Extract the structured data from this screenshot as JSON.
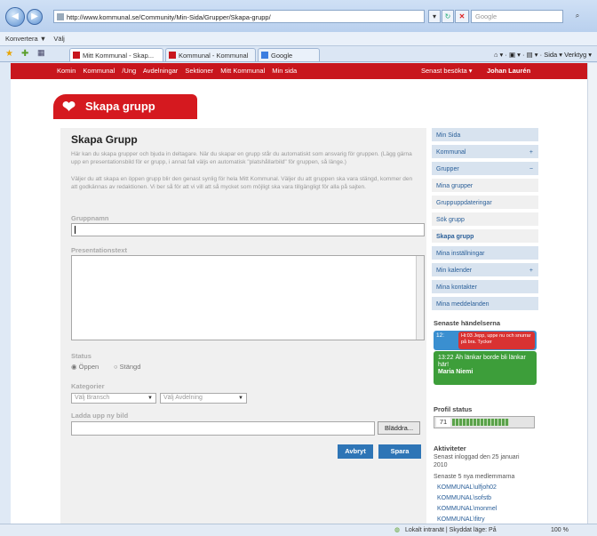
{
  "browser": {
    "url": "http://www.kommunal.se/Community/Min-Sida/Grupper/Skapa-grupp/",
    "search_placeholder": "Google",
    "links_bar": [
      "Konvertera",
      "▼",
      "Välj"
    ],
    "tabs": [
      "Mitt Kommunal - Skap...",
      "Kommunal - Kommunal",
      "Google"
    ],
    "tools": "Sida ▾  Verktyg ▾",
    "status_zone": "Lokalt intranät | Skyddat läge: På",
    "zoom": "100 %"
  },
  "site_nav": {
    "links": [
      "Komin",
      "Kommunal",
      "/Ung",
      "Avdelningar",
      "Sektioner",
      "Mitt Kommunal",
      "Min sida"
    ],
    "latest": "Senast besökta ▾",
    "user": "Johan Laurén"
  },
  "header": {
    "badge": "Skapa grupp"
  },
  "form": {
    "title": "Skapa Grupp",
    "intro1": "Här kan du skapa grupper och bjuda in deltagare. När du skapar en grupp står du automatiskt som ansvarig för gruppen. (Lägg gärna upp en presentationsbild för er grupp, i annat fall väljs en automatisk \"platshållarbild\" för gruppen, så länge.)",
    "intro2": "Väljer du att skapa en öppen grupp blir den genast synlig för hela Mitt Kommunal. Väljer du att gruppen ska vara stängd, kommer den att godkännas av redaktionen. Vi ber så för att vi vill att så mycket som möjligt ska vara tillgängligt för alla på sajten.",
    "name_label": "Gruppnamn",
    "name_value": "",
    "presentation_label": "Presentationstext",
    "status_label": "Status",
    "status_open": "Öppen",
    "status_closed": "Stängd",
    "category_label": "Kategorier",
    "branch_select": "Välj Bransch",
    "department_select": "Välj Avdelning",
    "upload_label": "Ladda upp ny bild",
    "browse": "Bläddra...",
    "cancel": "Avbryt",
    "save": "Spara"
  },
  "sidebar": {
    "items": [
      {
        "label": "Min Sida",
        "mark": ""
      },
      {
        "label": "Kommunal",
        "mark": "+"
      },
      {
        "label": "Grupper",
        "mark": "−"
      },
      {
        "label": "Mina grupper",
        "mark": ""
      },
      {
        "label": "Gruppuppdateringar",
        "mark": ""
      },
      {
        "label": "Sök grupp",
        "mark": ""
      },
      {
        "label": "Skapa grupp",
        "mark": ""
      },
      {
        "label": "Mina inställningar",
        "mark": ""
      },
      {
        "label": "Min kalender",
        "mark": "+"
      },
      {
        "label": "Mina kontakter",
        "mark": ""
      },
      {
        "label": "Mina meddelanden",
        "mark": ""
      }
    ],
    "events_title": "Senaste händelserna",
    "event_red": "Hi:03 Jepp, uppe nu och snurrar på bra. Tycker",
    "event_blue_time": "12:",
    "event_green": "13:22 Äh länkar borde bli länkar här!",
    "event_green_name": "Maria Niemi",
    "profile_title": "Profil status",
    "profile_value": "71",
    "activities_title": "Aktiviteter",
    "last_login": "Senast inloggad den 25 januari 2010",
    "new_members_title": "Senaste 5 nya medlemmarna",
    "members": [
      "KOMMUNAL\\ulfjoh02",
      "KOMMUNAL\\sofstb",
      "KOMMUNAL\\monmel",
      "KOMMUNAL\\fitry"
    ]
  }
}
